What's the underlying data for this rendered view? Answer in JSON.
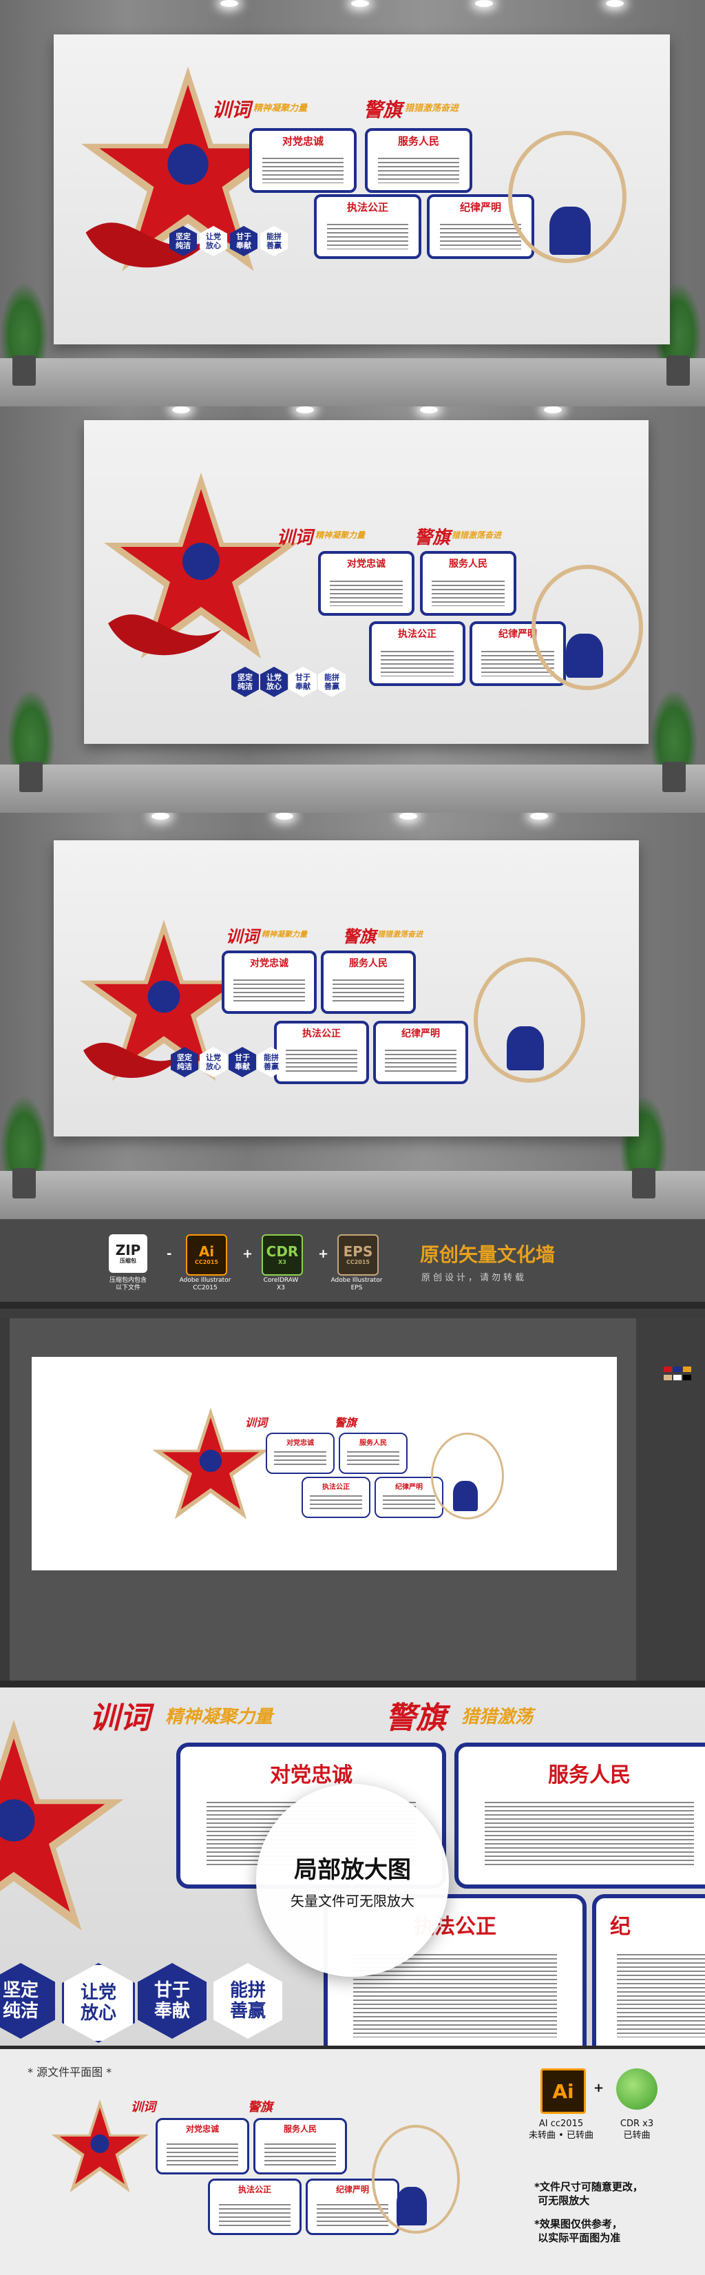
{
  "wall": {
    "title_left": "训词",
    "title_left_slogan": "精神凝聚力量",
    "title_right": "警旗",
    "title_right_slogan": "猎猎激荡奋进",
    "box1": "对党忠诚",
    "box2": "服务人民",
    "box3": "执法公正",
    "box4": "纪律严明",
    "side_caption": "警旗",
    "hexes": [
      "坚定\n纯洁",
      "让党\n放心",
      "甘于\n奉献",
      "能拼\n善赢"
    ]
  },
  "formats": {
    "zip": {
      "big": "ZIP",
      "small": "压缩包",
      "caption": "压缩包内包含\n以下文件"
    },
    "ai": {
      "big": "Ai",
      "small": "CC2015",
      "caption": "Adobe Illustrator\nCC2015"
    },
    "cdr": {
      "big": "CDR",
      "small": "X3",
      "caption": "CorelDRAW\nX3"
    },
    "eps": {
      "big": "EPS",
      "small": "CC2015",
      "caption": "Adobe Illustrator\nEPS"
    },
    "op1": "-",
    "op2": "+",
    "op3": "+"
  },
  "promo": {
    "title": "原创矢量文化墙",
    "subtitle": "原创设计，请勿转载"
  },
  "zoom": {
    "lens_title": "局部放大图",
    "lens_subtitle": "矢量文件可无限放大",
    "banner_left": "训词",
    "banner_left_slogan": "精神凝聚力量",
    "banner_right": "警旗",
    "banner_right_slogan": "猎猎激荡",
    "box1": "对党忠诚",
    "box2": "服务人民",
    "box3": "执法公正",
    "box4": "纪",
    "hexes": [
      "坚定\n纯洁",
      "让党\n放心",
      "甘于\n奉献",
      "能拼\n善赢"
    ]
  },
  "bottom": {
    "label": "* 源文件平面图 *",
    "ai_icon": "Ai",
    "plus": "+",
    "ai_caption": "AI cc2015\n未转曲 • 已转曲",
    "cdr_caption": "CDR x3\n已转曲",
    "note1": "*文件尺寸可随意更改，\n 可无限放大",
    "note2": "*效果图仅供参考，\n 以实际平面图为准"
  },
  "colors": {
    "accent_red": "#d0141c",
    "accent_blue": "#1f2e8c",
    "accent_gold": "#e8a11c"
  }
}
